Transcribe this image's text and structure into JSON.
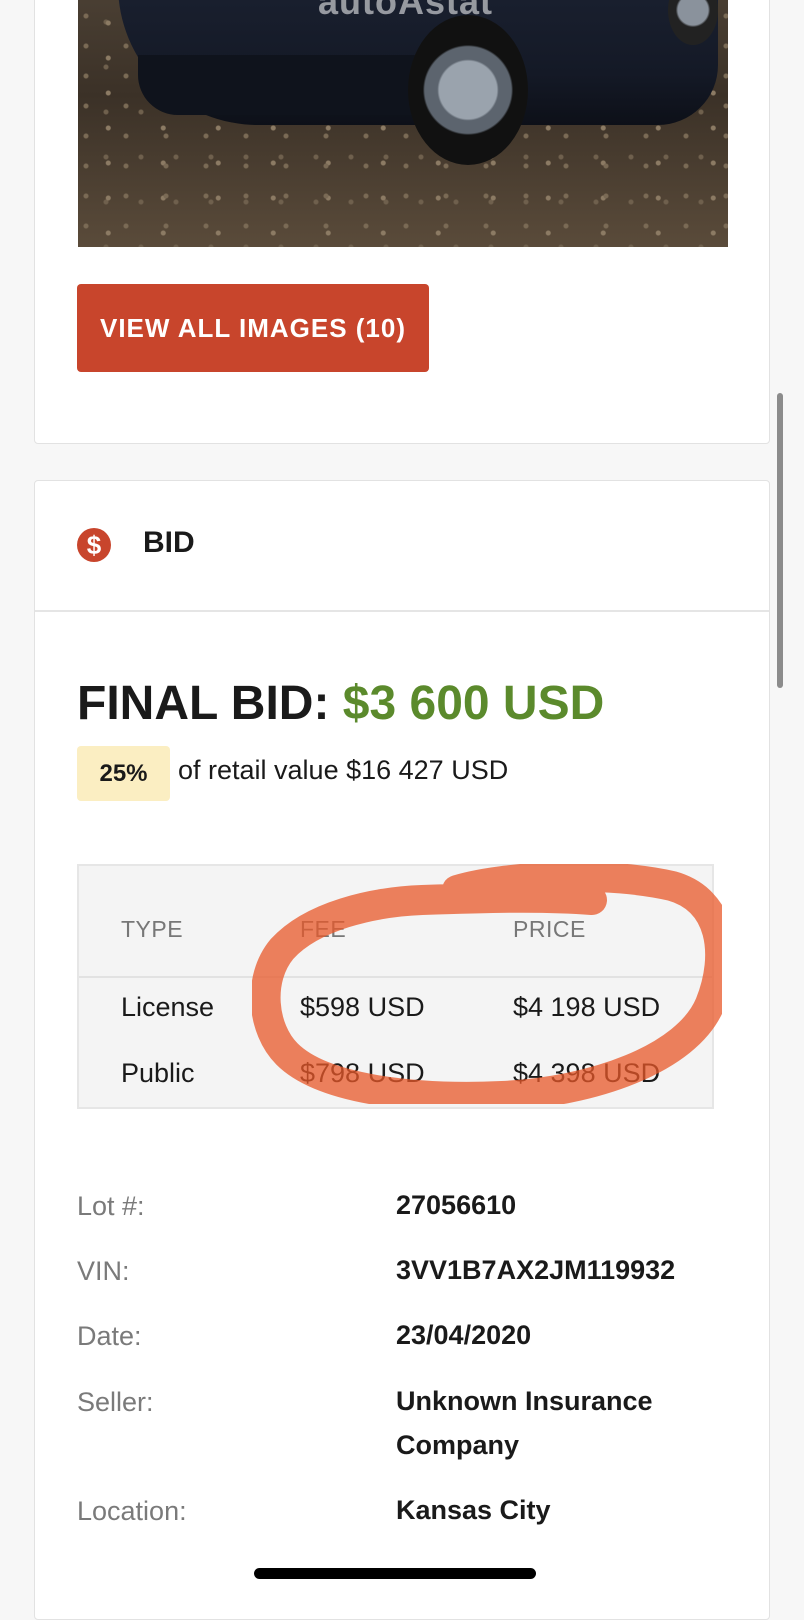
{
  "gallery": {
    "watermark": "autoAstat",
    "view_all_label": "VIEW ALL IMAGES (10)"
  },
  "bid": {
    "icon": "dollar-circle-icon",
    "icon_glyph": "$",
    "title": "BID",
    "final_label": "FINAL BID:",
    "final_amount": "$3 600 USD",
    "percent_badge": "25%",
    "retail_text": "of retail value $16 427 USD",
    "fee_table": {
      "headers": [
        "TYPE",
        "FEE",
        "PRICE"
      ],
      "rows": [
        [
          "License",
          "$598 USD",
          "$4 198 USD"
        ],
        [
          "Public",
          "$798 USD",
          "$4 398 USD"
        ]
      ]
    },
    "details": [
      {
        "label": "Lot #:",
        "value": "27056610"
      },
      {
        "label": "VIN:",
        "value": "3VV1B7AX2JM119932"
      },
      {
        "label": "Date:",
        "value": "23/04/2020"
      },
      {
        "label": "Seller:",
        "value": "Unknown Insurance Company"
      },
      {
        "label": "Location:",
        "value": "Kansas City"
      }
    ]
  },
  "colors": {
    "accent": "#c8452c",
    "final_amount": "#5b8a2c",
    "badge_bg": "#fbeec2",
    "annotation": "#e8582a"
  }
}
